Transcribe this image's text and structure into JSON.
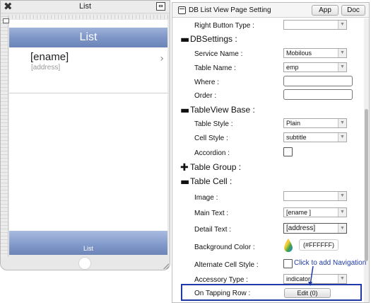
{
  "device": {
    "title": "List",
    "nav_title": "List",
    "row": {
      "main_text": "[ename]",
      "detail_text": "[address]"
    },
    "tab_label": "List"
  },
  "panel": {
    "title": "DB List View Page Setting",
    "app_button": "App",
    "doc_button": "Doc",
    "right_button_type_label": "Right Button Type :",
    "right_button_type_value": "",
    "db_settings_section": "DBSettings :",
    "service_name_label": "Service Name :",
    "service_name_value": "Mobilous",
    "table_name_label": "Table Name :",
    "table_name_value": "emp",
    "where_label": "Where :",
    "order_label": "Order :",
    "tableview_section": "TableView Base :",
    "table_style_label": "Table Style :",
    "table_style_value": "Plain",
    "cell_style_label": "Cell Style :",
    "cell_style_value": "subtitle",
    "accordion_label": "Accordion :",
    "table_group_section": "Table Group :",
    "table_cell_section": "Table Cell :",
    "image_label": "Image :",
    "image_value": "",
    "main_text_label": "Main Text :",
    "main_text_value": "[ename ]",
    "detail_text_label": "Detail Text :",
    "detail_text_value": "[address]",
    "background_color_label": "Background Color :",
    "background_color_value": "(#FFFFFF)",
    "alternate_cell_style_label": "Alternate Cell Style :",
    "accessory_type_label": "Accessory Type :",
    "accessory_type_value": "indicator",
    "on_tapping_row_label": "On Tapping Row :",
    "edit_button": "Edit (0)"
  },
  "annotation": {
    "text": "Click to add Navigation"
  },
  "colors": {
    "nav_blue": "#7e96c7",
    "annotation_blue": "#1f3aa8"
  }
}
